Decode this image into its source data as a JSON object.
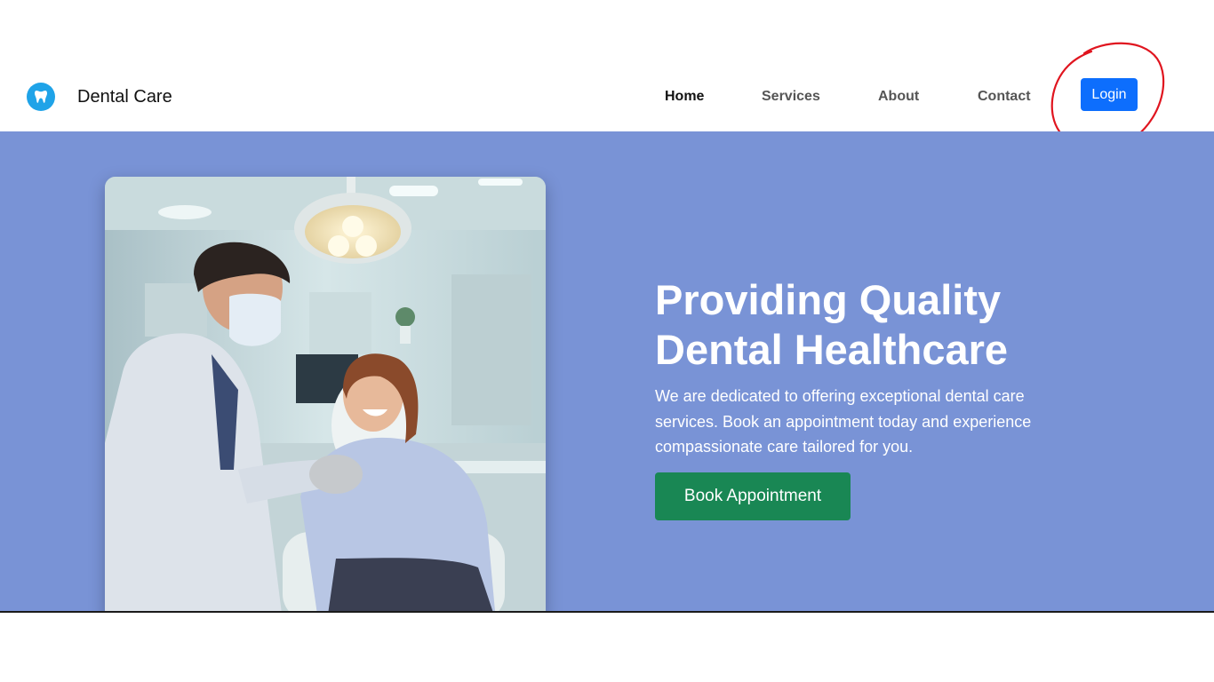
{
  "brand": {
    "name": "Dental Care",
    "icon": "tooth-icon"
  },
  "nav": {
    "items": [
      {
        "label": "Home",
        "active": true
      },
      {
        "label": "Services",
        "active": false
      },
      {
        "label": "About",
        "active": false
      },
      {
        "label": "Contact",
        "active": false
      }
    ],
    "login_label": "Login"
  },
  "hero": {
    "title_line1": "Providing Quality",
    "title_line2": "Dental Healthcare",
    "text": "We are dedicated to offering exceptional dental care services. Book an appointment today and experience compassionate care tailored for you.",
    "cta_label": "Book Appointment"
  },
  "colors": {
    "hero_bg": "#7993d6",
    "primary": "#0d6efd",
    "success": "#198754",
    "brand_icon": "#1fa3e8",
    "annotation": "#e0151f"
  }
}
